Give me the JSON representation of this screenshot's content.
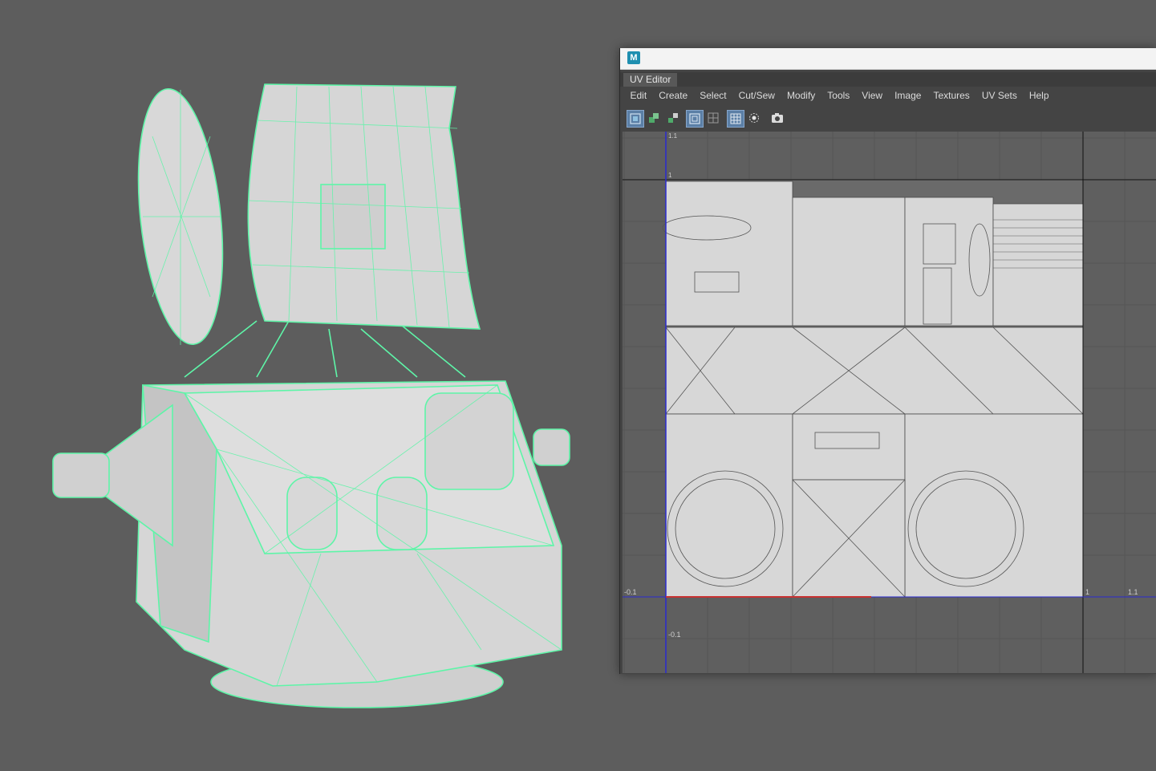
{
  "window": {
    "app_icon_letter": "M",
    "tab": "UV Editor",
    "menu": [
      "Edit",
      "Create",
      "Select",
      "Cut/Sew",
      "Modify",
      "Tools",
      "View",
      "Image",
      "Textures",
      "UV Sets",
      "Help"
    ]
  },
  "toolbar": {
    "icons": [
      "uv-shell-icon",
      "uv-face-icon",
      "uv-flip-icon",
      "uv-bounds-icon",
      "uv-grid-small-icon",
      "grid-toggle-icon",
      "checker-display-icon",
      "snapshot-icon"
    ]
  },
  "uv_axis_labels": {
    "top": "1.1",
    "one_top": "1",
    "left_bottom": "-0.1",
    "bottom_neg": "-0.1",
    "right_one": "1",
    "right_onepoint": "1.1"
  },
  "colors": {
    "wireframe": "#5ef5a8",
    "mesh": "#d9d9d9",
    "uv_lines": "#3a3a3a",
    "u_axis": "#c83232",
    "v_axis": "#2a2ad0"
  }
}
